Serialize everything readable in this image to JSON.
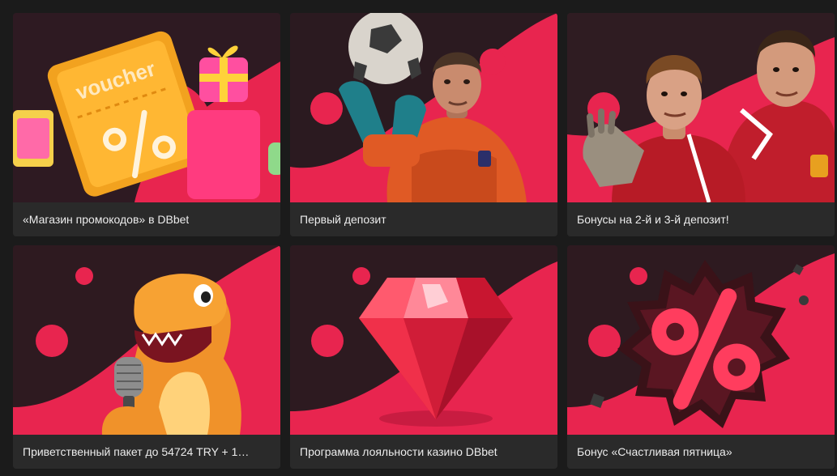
{
  "promos": [
    {
      "title": "«Магазин промокодов» в DBbet",
      "voucher_text": "voucher",
      "art_icon": "voucher-gift-icon"
    },
    {
      "title": "Первый депозит",
      "art_icon": "goalkeeper-ball-icon"
    },
    {
      "title": "Бонусы на 2-й и 3-й депозит!",
      "art_icon": "football-players-icon"
    },
    {
      "title": "Приветственный пакет до 54724 TRY + 1…",
      "art_icon": "dinosaur-microphone-icon"
    },
    {
      "title": "Программа лояльности казино DBbet",
      "art_icon": "ruby-gem-icon"
    },
    {
      "title": "Бонус «Счастливая пятница»",
      "art_icon": "percent-badge-icon"
    }
  ],
  "colors": {
    "accent": "#e8254f",
    "card_bg": "#262626",
    "page_bg": "#1b1b1b",
    "caption_text": "#ececec"
  }
}
